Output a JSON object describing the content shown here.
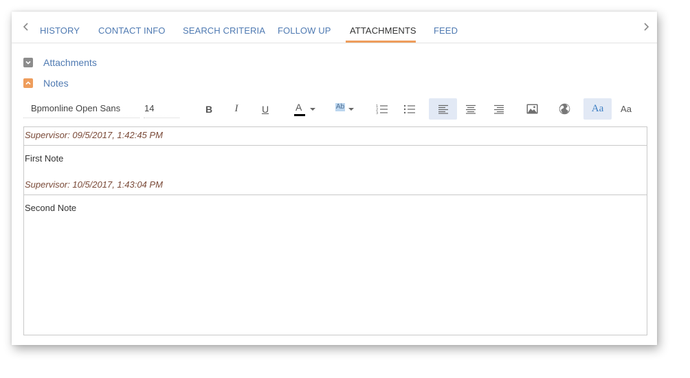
{
  "tabs": {
    "items": [
      {
        "label": "HISTORY"
      },
      {
        "label": "CONTACT INFO"
      },
      {
        "label": "SEARCH CRITERIA"
      },
      {
        "label": "FOLLOW UP"
      },
      {
        "label": "ATTACHMENTS",
        "active": true
      },
      {
        "label": "FEED"
      }
    ],
    "prev_icon": "chevron-left-icon",
    "next_icon": "chevron-right-icon",
    "active_underline_color": "#ee9d5c",
    "link_color": "#4f7ab2"
  },
  "groups": {
    "attachments": {
      "label": "Attachments",
      "state": "collapsed",
      "toggle_color": "#8c8c8c"
    },
    "notes": {
      "label": "Notes",
      "state": "expanded",
      "toggle_color": "#ee9d5c"
    }
  },
  "toolbar": {
    "font_family": "Bpmonline Open Sans",
    "font_size": "14",
    "bold": "B",
    "italic": "I",
    "underline": "U",
    "font_color_glyph": "A",
    "font_color_value": "#000000",
    "highlight_glyph": "Ab",
    "highlight_color": "#bcd6ef",
    "serif_font_glyph": "Aa",
    "sans_font_glyph": "Aa",
    "align_left_selected": true,
    "serif_font_selected": true
  },
  "notes": [
    {
      "meta": "Supervisor: 09/5/2017, 1:42:45 PM",
      "text": "First Note"
    },
    {
      "meta": "Supervisor: 10/5/2017, 1:43:04 PM",
      "text": "Second Note"
    }
  ]
}
